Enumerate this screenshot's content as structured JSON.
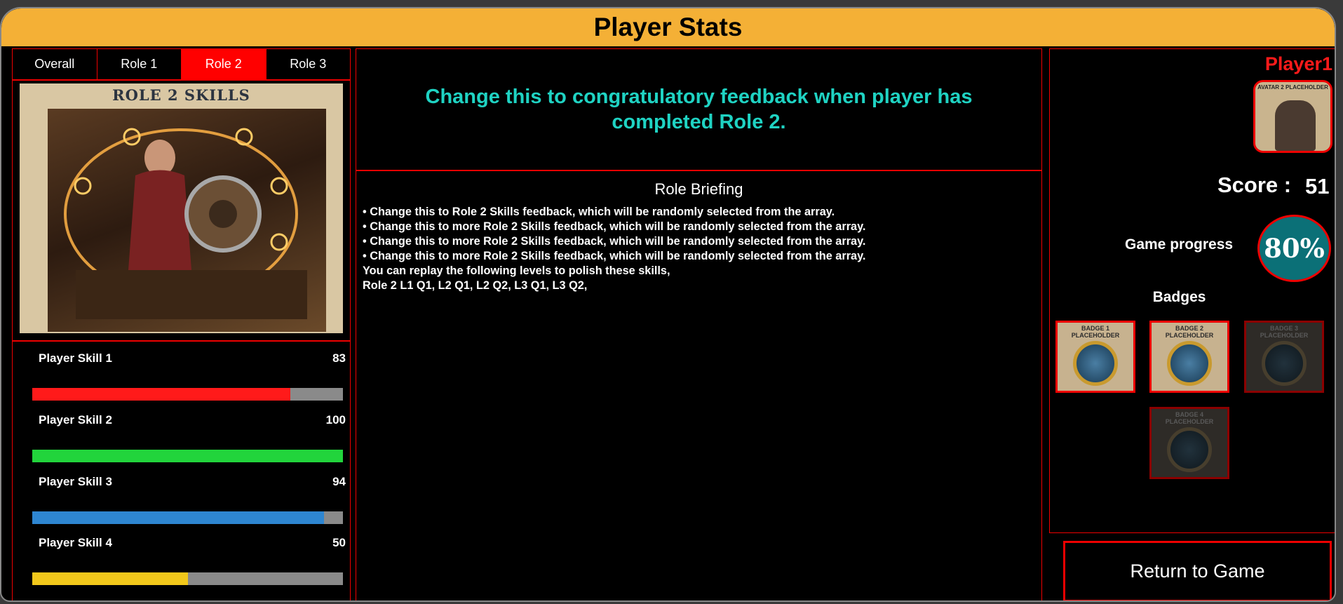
{
  "header": {
    "title": "Player Stats"
  },
  "tabs": [
    {
      "label": "Overall",
      "active": false
    },
    {
      "label": "Role 1",
      "active": false
    },
    {
      "label": "Role 2",
      "active": true
    },
    {
      "label": "Role 3",
      "active": false
    }
  ],
  "role_image": {
    "heading": "ROLE 2 SKILLS"
  },
  "skills": [
    {
      "name": "Player Skill 1",
      "value": "83",
      "fraction": 0.83,
      "color": "#ff1a1a"
    },
    {
      "name": "Player Skill 2",
      "value": "100",
      "fraction": 1.0,
      "color": "#22d43c"
    },
    {
      "name": "Player Skill 3",
      "value": "94",
      "fraction": 0.94,
      "color": "#2e86d1"
    },
    {
      "name": "Player Skill 4",
      "value": "50",
      "fraction": 0.5,
      "color": "#f2c81b"
    }
  ],
  "feedback": {
    "text": "Change this to congratulatory feedback when player has completed Role 2."
  },
  "briefing": {
    "title": "Role Briefing",
    "lines": [
      "• Change this to Role 2 Skills feedback, which will be randomly selected from the array.",
      "• Change this to more Role 2 Skills feedback, which will be randomly selected from the array.",
      "• Change this to more Role 2 Skills feedback, which will be randomly selected from the array.",
      "• Change this to more Role 2 Skills feedback, which will be randomly selected from the array.",
      "You can replay the following levels to polish these skills,",
      "Role 2 L1 Q1, L2 Q1, L2 Q2, L3 Q1, L3 Q2,"
    ]
  },
  "profile": {
    "player_name": "Player1",
    "avatar_caption": "AVATAR 2 PLACEHOLDER",
    "score_label": "Score :",
    "score_value": "51",
    "progress_label": "Game progress",
    "progress_value": "80%",
    "badges_title": "Badges",
    "badges": [
      {
        "caption": "BADGE 1 PLACEHOLDER",
        "unlocked": true
      },
      {
        "caption": "BADGE 2 PLACEHOLDER",
        "unlocked": true
      },
      {
        "caption": "BADGE 3 PLACEHOLDER",
        "unlocked": false
      },
      {
        "caption": "BADGE 4 PLACEHOLDER",
        "unlocked": false
      }
    ]
  },
  "actions": {
    "return_label": "Return to Game"
  },
  "colors": {
    "accent": "#f4b036",
    "border": "#ee0000",
    "feedback_text": "#1fd3c3",
    "active_tab": "#ff0000",
    "progress_bg": "#0b7077"
  }
}
